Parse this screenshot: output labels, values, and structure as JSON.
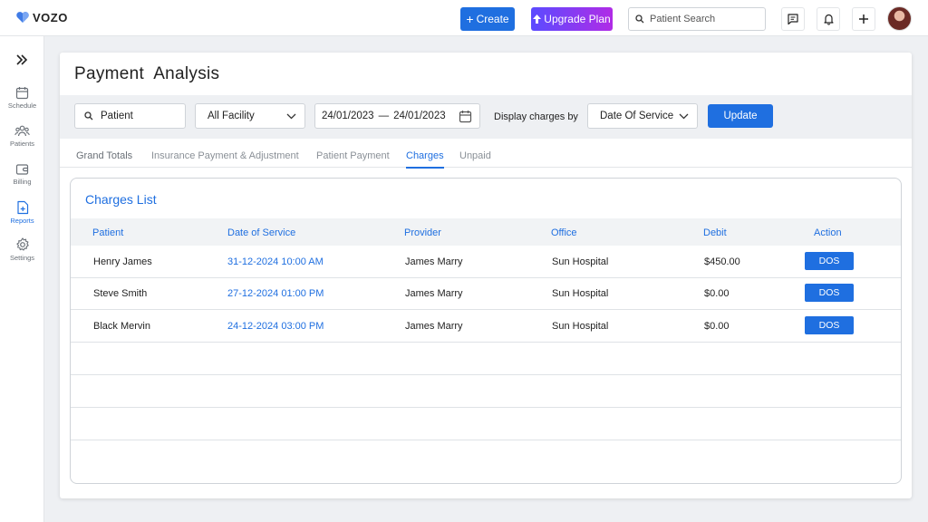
{
  "app": {
    "logo_text": "VOZO",
    "brand_color": "#1f6fe0"
  },
  "topbar": {
    "create_label": "Create",
    "upgrade_label": "Upgrade Plan",
    "search_placeholder": "Patient Search"
  },
  "sidebar": {
    "items": [
      {
        "label": "Schedule",
        "icon": "calendar-icon"
      },
      {
        "label": "Patients",
        "icon": "users-icon"
      },
      {
        "label": "Billing",
        "icon": "wallet-icon"
      },
      {
        "label": "Reports",
        "icon": "reports-icon",
        "active": true
      },
      {
        "label": "Settings",
        "icon": "gear-icon"
      }
    ]
  },
  "page": {
    "title": "Payment  Analysis"
  },
  "filters": {
    "patient_placeholder": "Patient",
    "facility_value": "All Facility",
    "date_from": "24/01/2023",
    "date_to": "24/01/2023",
    "display_label": "Display charges by",
    "display_value": "Date Of Service",
    "update_label": "Update"
  },
  "tabs": [
    {
      "label": "Grand Totals"
    },
    {
      "label": "Insurance Payment & Adjustment"
    },
    {
      "label": "Patient Payment"
    },
    {
      "label": "Charges",
      "active": true
    },
    {
      "label": "Unpaid"
    }
  ],
  "charges": {
    "title": "Charges List",
    "columns": [
      "Patient",
      "Date of Service",
      "Provider",
      "Office",
      "Debit",
      "Action"
    ],
    "rows": [
      {
        "patient": "Henry James",
        "date": "31-12-2024 10:00 AM",
        "provider": "James Marry",
        "office": "Sun Hospital",
        "debit": "$450.00",
        "action": "DOS"
      },
      {
        "patient": "Steve Smith",
        "date": "27-12-2024 01:00 PM",
        "provider": "James Marry",
        "office": "Sun Hospital",
        "debit": "$0.00",
        "action": "DOS"
      },
      {
        "patient": "Black Mervin",
        "date": "24-12-2024 03:00 PM",
        "provider": "James Marry",
        "office": "Sun Hospital",
        "debit": "$0.00",
        "action": "DOS"
      }
    ]
  }
}
